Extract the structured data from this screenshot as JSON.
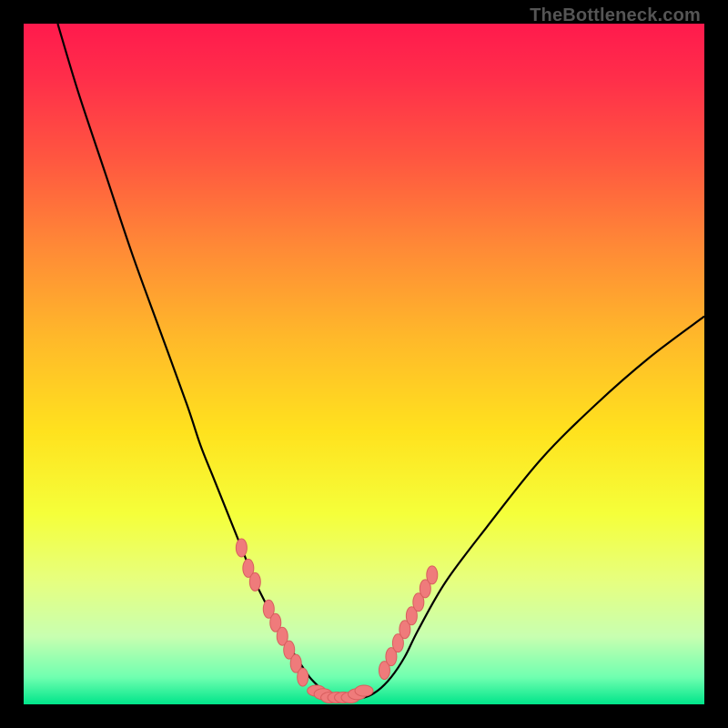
{
  "attribution": "TheBottleneck.com",
  "colors": {
    "background": "#000000",
    "gradient_top": "#ff1a4d",
    "gradient_bottom": "#00e58a",
    "curve": "#000000",
    "marker_fill": "#ef7b7b",
    "marker_stroke": "#d85e5e"
  },
  "chart_data": {
    "type": "line",
    "title": "",
    "xlabel": "",
    "ylabel": "",
    "xlim": [
      0,
      100
    ],
    "ylim": [
      0,
      100
    ],
    "grid": false,
    "legend": false,
    "series": [
      {
        "name": "bottleneck-curve",
        "x": [
          5,
          8,
          12,
          16,
          20,
          24,
          26,
          28,
          30,
          32,
          34,
          36,
          38,
          40,
          42,
          44,
          45,
          46,
          48,
          50,
          52,
          54,
          56,
          58,
          62,
          68,
          76,
          84,
          92,
          100
        ],
        "y": [
          100,
          90,
          78,
          66,
          55,
          44,
          38,
          33,
          28,
          23,
          18,
          14,
          10,
          7,
          4,
          2,
          1,
          1,
          1,
          1,
          2,
          4,
          7,
          11,
          18,
          26,
          36,
          44,
          51,
          57
        ]
      }
    ],
    "markers_left": [
      {
        "x": 32,
        "y": 23
      },
      {
        "x": 33,
        "y": 20
      },
      {
        "x": 34,
        "y": 18
      },
      {
        "x": 36,
        "y": 14
      },
      {
        "x": 37,
        "y": 12
      },
      {
        "x": 38,
        "y": 10
      },
      {
        "x": 39,
        "y": 8
      },
      {
        "x": 40,
        "y": 6
      },
      {
        "x": 41,
        "y": 4
      }
    ],
    "markers_bottom": [
      {
        "x": 43,
        "y": 2
      },
      {
        "x": 44,
        "y": 1.5
      },
      {
        "x": 45,
        "y": 1
      },
      {
        "x": 46,
        "y": 1
      },
      {
        "x": 47,
        "y": 1
      },
      {
        "x": 48,
        "y": 1
      },
      {
        "x": 49,
        "y": 1.5
      },
      {
        "x": 50,
        "y": 2
      }
    ],
    "markers_right": [
      {
        "x": 53,
        "y": 5
      },
      {
        "x": 54,
        "y": 7
      },
      {
        "x": 55,
        "y": 9
      },
      {
        "x": 56,
        "y": 11
      },
      {
        "x": 57,
        "y": 13
      },
      {
        "x": 58,
        "y": 15
      },
      {
        "x": 59,
        "y": 17
      },
      {
        "x": 60,
        "y": 19
      }
    ]
  }
}
